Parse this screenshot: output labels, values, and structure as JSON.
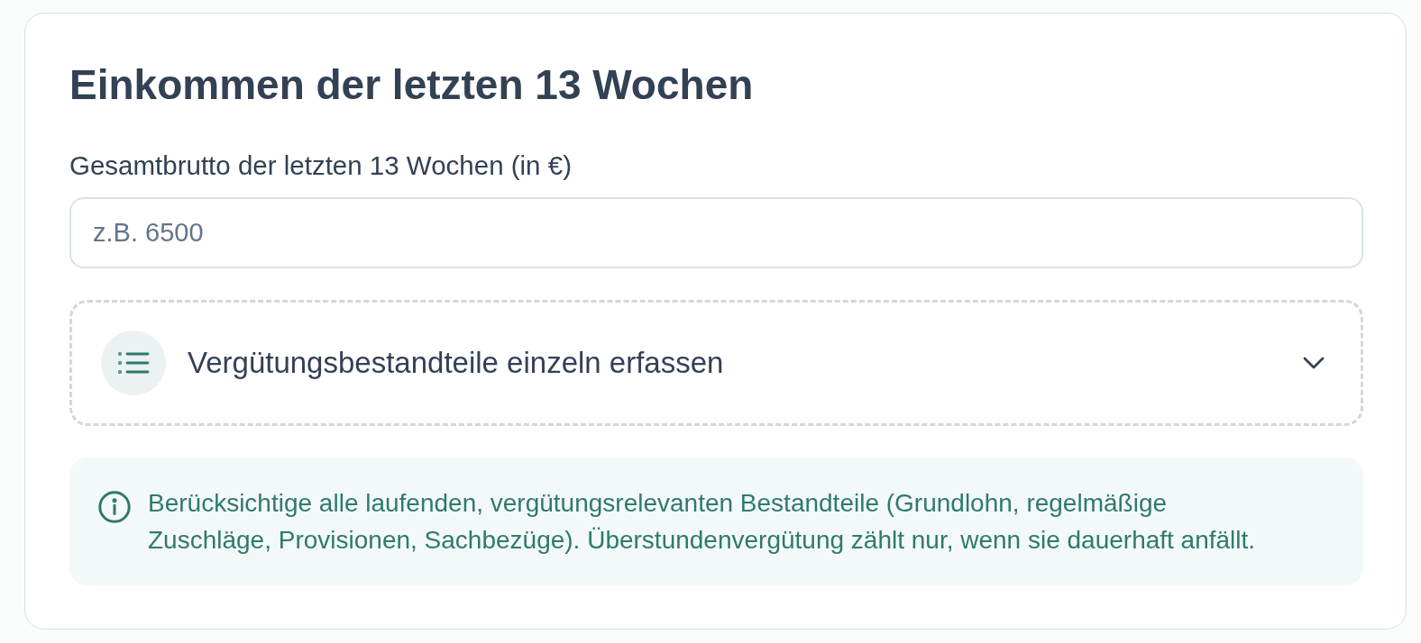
{
  "card": {
    "title": "Einkommen der letzten 13 Wochen",
    "field": {
      "label": "Gesamtbrutto der letzten 13 Wochen (in €)",
      "placeholder": "z.B. 6500"
    },
    "expander": {
      "label": "Vergütungsbestandteile einzeln erfassen",
      "expanded": false
    },
    "info": {
      "text": "Berücksichtige alle laufenden, vergütungsrelevanten Bestandteile (Grundlohn, regelmäßige Zuschläge, Provisionen, Sachbezüge). Überstundenvergütung zählt nur, wenn sie dauerhaft anfällt."
    }
  }
}
